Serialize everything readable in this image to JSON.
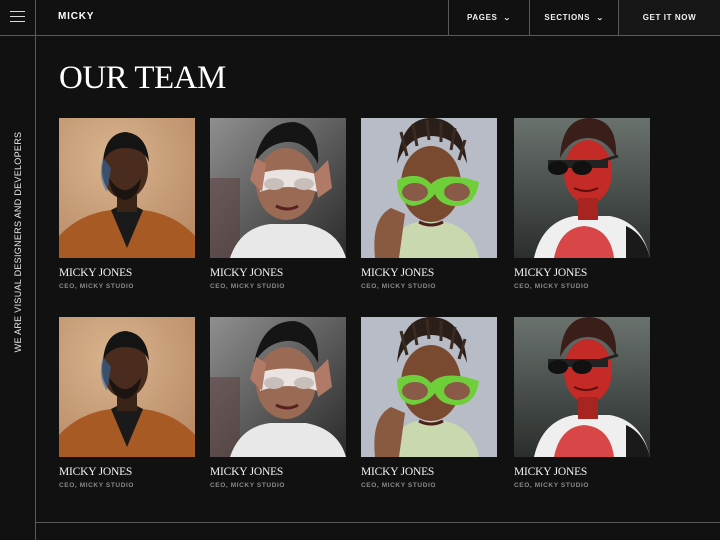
{
  "sidebar": {
    "tagline": "WE ARE VISUAL DESIGNERS AND DEVELOPERS"
  },
  "header": {
    "logo": "MICKY",
    "nav": {
      "pages": "PAGES",
      "sections": "SECTIONS",
      "cta": "GET IT NOW"
    }
  },
  "main": {
    "title": "OUR TEAM",
    "members": [
      {
        "name": "MICKY JONES",
        "role": "CEO, MICKY STUDIO",
        "photo": "portrait-orange-jacket"
      },
      {
        "name": "MICKY JONES",
        "role": "CEO, MICKY STUDIO",
        "photo": "portrait-white-sunglasses"
      },
      {
        "name": "MICKY JONES",
        "role": "CEO, MICKY STUDIO",
        "photo": "portrait-green-sunglasses"
      },
      {
        "name": "MICKY JONES",
        "role": "CEO, MICKY STUDIO",
        "photo": "portrait-red-light"
      },
      {
        "name": "MICKY JONES",
        "role": "CEO, MICKY STUDIO",
        "photo": "portrait-orange-jacket"
      },
      {
        "name": "MICKY JONES",
        "role": "CEO, MICKY STUDIO",
        "photo": "portrait-white-sunglasses"
      },
      {
        "name": "MICKY JONES",
        "role": "CEO, MICKY STUDIO",
        "photo": "portrait-green-sunglasses"
      },
      {
        "name": "MICKY JONES",
        "role": "CEO, MICKY STUDIO",
        "photo": "portrait-red-light"
      }
    ]
  },
  "colors": {
    "background": "#111112",
    "border": "#5a5a5a",
    "text": "#f2f2f2",
    "muted": "#8a8a8a"
  }
}
